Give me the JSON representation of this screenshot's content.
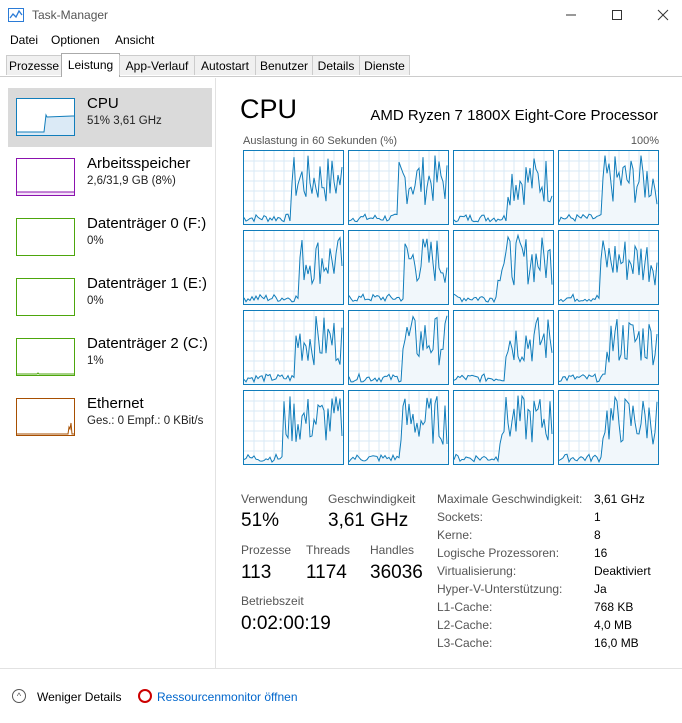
{
  "window": {
    "title": "Task-Manager",
    "app_icon": "task-manager-icon",
    "controls": [
      "minimize",
      "maximize",
      "close"
    ]
  },
  "menu": [
    "Datei",
    "Optionen",
    "Ansicht"
  ],
  "tabs": [
    "Prozesse",
    "Leistung",
    "App-Verlauf",
    "Autostart",
    "Benutzer",
    "Details",
    "Dienste"
  ],
  "active_tab": "Leistung",
  "sidebar": [
    {
      "title": "CPU",
      "sub": "51% 3,61 GHz",
      "color": "#117dbb",
      "selected": true
    },
    {
      "title": "Arbeitsspeicher",
      "sub": "2,6/31,9 GB (8%)",
      "color": "#8b12ae"
    },
    {
      "title": "Datenträger 0 (F:)",
      "sub": "0%",
      "color": "#4da60c"
    },
    {
      "title": "Datenträger 1 (E:)",
      "sub": "0%",
      "color": "#4da60c"
    },
    {
      "title": "Datenträger 2 (C:)",
      "sub": "1%",
      "color": "#4da60c"
    },
    {
      "title": "Ethernet",
      "sub": "Ges.: 0 Empf.: 0 KBit/s",
      "color": "#a74f01"
    }
  ],
  "cpu": {
    "title": "CPU",
    "model": "AMD Ryzen 7 1800X Eight-Core Processor",
    "graph_label": "Auslastung in 60 Sekunden (%)",
    "graph_max": "100%",
    "graph_color": "#117dbb",
    "logical_processor_graphs": 16
  },
  "stats": {
    "usage_label": "Verwendung",
    "usage": "51%",
    "speed_label": "Geschwindigkeit",
    "speed": "3,61 GHz",
    "processes_label": "Prozesse",
    "processes": "113",
    "threads_label": "Threads",
    "threads": "1174",
    "handles_label": "Handles",
    "handles": "36036",
    "uptime_label": "Betriebszeit",
    "uptime": "0:02:00:19"
  },
  "details": [
    {
      "label": "Maximale Geschwindigkeit:",
      "value": "3,61 GHz"
    },
    {
      "label": "Sockets:",
      "value": "1"
    },
    {
      "label": "Kerne:",
      "value": "8"
    },
    {
      "label": "Logische Prozessoren:",
      "value": "16"
    },
    {
      "label": "Virtualisierung:",
      "value": "Deaktiviert"
    },
    {
      "label": "Hyper-V-Unterstützung:",
      "value": "Ja"
    },
    {
      "label": "L1-Cache:",
      "value": "768 KB"
    },
    {
      "label": "L2-Cache:",
      "value": "4,0 MB"
    },
    {
      "label": "L3-Cache:",
      "value": "16,0 MB"
    }
  ],
  "footer": {
    "fewer_details": "Weniger Details",
    "resource_monitor": "Ressourcenmonitor öffnen"
  }
}
